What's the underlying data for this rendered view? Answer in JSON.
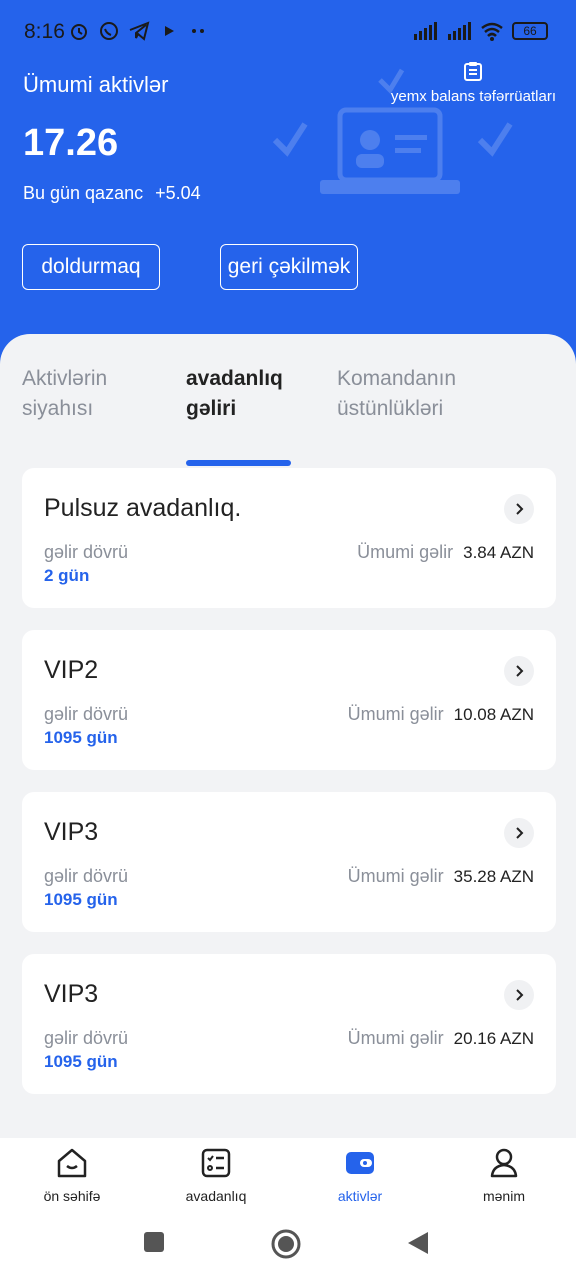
{
  "status_bar": {
    "time": "8:16",
    "battery": "66"
  },
  "header": {
    "title": "Ümumi aktivlər",
    "details_link": "yemx balans təfərrüatları",
    "total": "17.26",
    "today_label": "Bu gün qazanc",
    "today_value": "+5.04",
    "deposit_label": "doldurmaq",
    "withdraw_label": "geri çəkilmək"
  },
  "tabs": [
    {
      "label": "Aktivlərin siyahısı",
      "active": false
    },
    {
      "label": "avadanlıq gəliri",
      "active": true
    },
    {
      "label": "Komandanın üstünlükləri",
      "active": false
    }
  ],
  "cards": [
    {
      "title": "Pulsuz avadanlıq.",
      "period_label": "gəlir dövrü",
      "period_value": "2 gün",
      "income_label": "Ümumi gəlir",
      "income_value": "3.84 AZN"
    },
    {
      "title": "VIP2",
      "period_label": "gəlir dövrü",
      "period_value": "1095 gün",
      "income_label": "Ümumi gəlir",
      "income_value": "10.08 AZN"
    },
    {
      "title": "VIP3",
      "period_label": "gəlir dövrü",
      "period_value": "1095 gün",
      "income_label": "Ümumi gəlir",
      "income_value": "35.28 AZN"
    },
    {
      "title": "VIP3",
      "period_label": "gəlir dövrü",
      "period_value": "1095 gün",
      "income_label": "Ümumi gəlir",
      "income_value": "20.16 AZN"
    }
  ],
  "bottom_nav": [
    {
      "label": "ön səhifə",
      "icon": "home-icon",
      "active": false
    },
    {
      "label": "avadanlıq",
      "icon": "checklist-icon",
      "active": false
    },
    {
      "label": "aktivlər",
      "icon": "wallet-icon",
      "active": true
    },
    {
      "label": "mənim",
      "icon": "user-icon",
      "active": false
    }
  ],
  "colors": {
    "primary": "#2563eb",
    "background": "#f2f3f5",
    "card": "#ffffff"
  }
}
